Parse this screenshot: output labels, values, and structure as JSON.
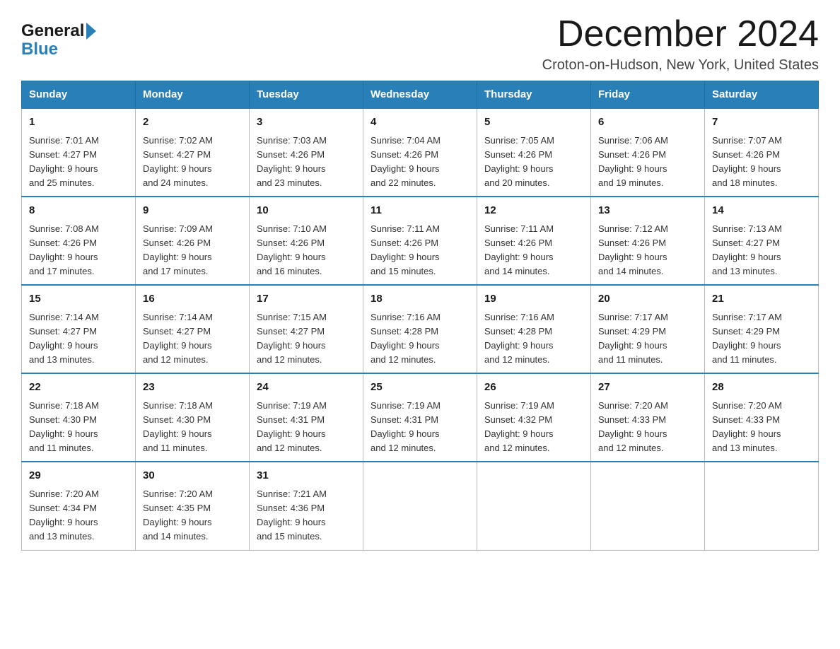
{
  "header": {
    "logo_general": "General",
    "logo_arrow": "▶",
    "logo_blue": "Blue",
    "month_title": "December 2024",
    "location": "Croton-on-Hudson, New York, United States"
  },
  "days_of_week": [
    "Sunday",
    "Monday",
    "Tuesday",
    "Wednesday",
    "Thursday",
    "Friday",
    "Saturday"
  ],
  "weeks": [
    [
      {
        "day": "1",
        "sunrise": "Sunrise: 7:01 AM",
        "sunset": "Sunset: 4:27 PM",
        "daylight": "Daylight: 9 hours",
        "daylight2": "and 25 minutes."
      },
      {
        "day": "2",
        "sunrise": "Sunrise: 7:02 AM",
        "sunset": "Sunset: 4:27 PM",
        "daylight": "Daylight: 9 hours",
        "daylight2": "and 24 minutes."
      },
      {
        "day": "3",
        "sunrise": "Sunrise: 7:03 AM",
        "sunset": "Sunset: 4:26 PM",
        "daylight": "Daylight: 9 hours",
        "daylight2": "and 23 minutes."
      },
      {
        "day": "4",
        "sunrise": "Sunrise: 7:04 AM",
        "sunset": "Sunset: 4:26 PM",
        "daylight": "Daylight: 9 hours",
        "daylight2": "and 22 minutes."
      },
      {
        "day": "5",
        "sunrise": "Sunrise: 7:05 AM",
        "sunset": "Sunset: 4:26 PM",
        "daylight": "Daylight: 9 hours",
        "daylight2": "and 20 minutes."
      },
      {
        "day": "6",
        "sunrise": "Sunrise: 7:06 AM",
        "sunset": "Sunset: 4:26 PM",
        "daylight": "Daylight: 9 hours",
        "daylight2": "and 19 minutes."
      },
      {
        "day": "7",
        "sunrise": "Sunrise: 7:07 AM",
        "sunset": "Sunset: 4:26 PM",
        "daylight": "Daylight: 9 hours",
        "daylight2": "and 18 minutes."
      }
    ],
    [
      {
        "day": "8",
        "sunrise": "Sunrise: 7:08 AM",
        "sunset": "Sunset: 4:26 PM",
        "daylight": "Daylight: 9 hours",
        "daylight2": "and 17 minutes."
      },
      {
        "day": "9",
        "sunrise": "Sunrise: 7:09 AM",
        "sunset": "Sunset: 4:26 PM",
        "daylight": "Daylight: 9 hours",
        "daylight2": "and 17 minutes."
      },
      {
        "day": "10",
        "sunrise": "Sunrise: 7:10 AM",
        "sunset": "Sunset: 4:26 PM",
        "daylight": "Daylight: 9 hours",
        "daylight2": "and 16 minutes."
      },
      {
        "day": "11",
        "sunrise": "Sunrise: 7:11 AM",
        "sunset": "Sunset: 4:26 PM",
        "daylight": "Daylight: 9 hours",
        "daylight2": "and 15 minutes."
      },
      {
        "day": "12",
        "sunrise": "Sunrise: 7:11 AM",
        "sunset": "Sunset: 4:26 PM",
        "daylight": "Daylight: 9 hours",
        "daylight2": "and 14 minutes."
      },
      {
        "day": "13",
        "sunrise": "Sunrise: 7:12 AM",
        "sunset": "Sunset: 4:26 PM",
        "daylight": "Daylight: 9 hours",
        "daylight2": "and 14 minutes."
      },
      {
        "day": "14",
        "sunrise": "Sunrise: 7:13 AM",
        "sunset": "Sunset: 4:27 PM",
        "daylight": "Daylight: 9 hours",
        "daylight2": "and 13 minutes."
      }
    ],
    [
      {
        "day": "15",
        "sunrise": "Sunrise: 7:14 AM",
        "sunset": "Sunset: 4:27 PM",
        "daylight": "Daylight: 9 hours",
        "daylight2": "and 13 minutes."
      },
      {
        "day": "16",
        "sunrise": "Sunrise: 7:14 AM",
        "sunset": "Sunset: 4:27 PM",
        "daylight": "Daylight: 9 hours",
        "daylight2": "and 12 minutes."
      },
      {
        "day": "17",
        "sunrise": "Sunrise: 7:15 AM",
        "sunset": "Sunset: 4:27 PM",
        "daylight": "Daylight: 9 hours",
        "daylight2": "and 12 minutes."
      },
      {
        "day": "18",
        "sunrise": "Sunrise: 7:16 AM",
        "sunset": "Sunset: 4:28 PM",
        "daylight": "Daylight: 9 hours",
        "daylight2": "and 12 minutes."
      },
      {
        "day": "19",
        "sunrise": "Sunrise: 7:16 AM",
        "sunset": "Sunset: 4:28 PM",
        "daylight": "Daylight: 9 hours",
        "daylight2": "and 12 minutes."
      },
      {
        "day": "20",
        "sunrise": "Sunrise: 7:17 AM",
        "sunset": "Sunset: 4:29 PM",
        "daylight": "Daylight: 9 hours",
        "daylight2": "and 11 minutes."
      },
      {
        "day": "21",
        "sunrise": "Sunrise: 7:17 AM",
        "sunset": "Sunset: 4:29 PM",
        "daylight": "Daylight: 9 hours",
        "daylight2": "and 11 minutes."
      }
    ],
    [
      {
        "day": "22",
        "sunrise": "Sunrise: 7:18 AM",
        "sunset": "Sunset: 4:30 PM",
        "daylight": "Daylight: 9 hours",
        "daylight2": "and 11 minutes."
      },
      {
        "day": "23",
        "sunrise": "Sunrise: 7:18 AM",
        "sunset": "Sunset: 4:30 PM",
        "daylight": "Daylight: 9 hours",
        "daylight2": "and 11 minutes."
      },
      {
        "day": "24",
        "sunrise": "Sunrise: 7:19 AM",
        "sunset": "Sunset: 4:31 PM",
        "daylight": "Daylight: 9 hours",
        "daylight2": "and 12 minutes."
      },
      {
        "day": "25",
        "sunrise": "Sunrise: 7:19 AM",
        "sunset": "Sunset: 4:31 PM",
        "daylight": "Daylight: 9 hours",
        "daylight2": "and 12 minutes."
      },
      {
        "day": "26",
        "sunrise": "Sunrise: 7:19 AM",
        "sunset": "Sunset: 4:32 PM",
        "daylight": "Daylight: 9 hours",
        "daylight2": "and 12 minutes."
      },
      {
        "day": "27",
        "sunrise": "Sunrise: 7:20 AM",
        "sunset": "Sunset: 4:33 PM",
        "daylight": "Daylight: 9 hours",
        "daylight2": "and 12 minutes."
      },
      {
        "day": "28",
        "sunrise": "Sunrise: 7:20 AM",
        "sunset": "Sunset: 4:33 PM",
        "daylight": "Daylight: 9 hours",
        "daylight2": "and 13 minutes."
      }
    ],
    [
      {
        "day": "29",
        "sunrise": "Sunrise: 7:20 AM",
        "sunset": "Sunset: 4:34 PM",
        "daylight": "Daylight: 9 hours",
        "daylight2": "and 13 minutes."
      },
      {
        "day": "30",
        "sunrise": "Sunrise: 7:20 AM",
        "sunset": "Sunset: 4:35 PM",
        "daylight": "Daylight: 9 hours",
        "daylight2": "and 14 minutes."
      },
      {
        "day": "31",
        "sunrise": "Sunrise: 7:21 AM",
        "sunset": "Sunset: 4:36 PM",
        "daylight": "Daylight: 9 hours",
        "daylight2": "and 15 minutes."
      },
      null,
      null,
      null,
      null
    ]
  ]
}
